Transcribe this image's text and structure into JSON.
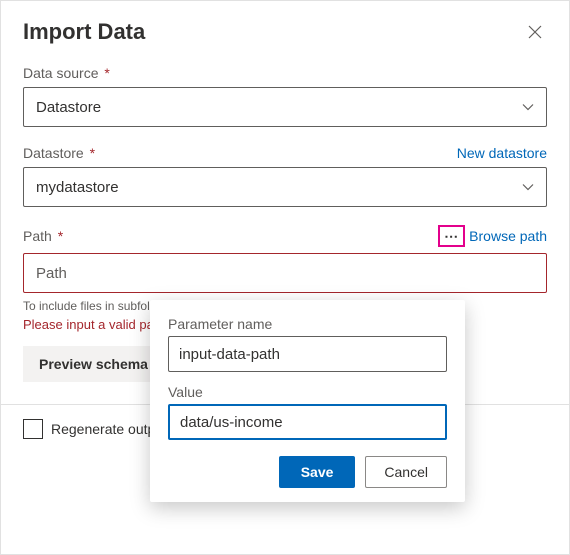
{
  "dialog": {
    "title": "Import Data"
  },
  "data_source": {
    "label": "Data source",
    "value": "Datastore"
  },
  "datastore": {
    "label": "Datastore",
    "new_link": "New datastore",
    "value": "mydatastore"
  },
  "path": {
    "label": "Path",
    "browse_link": "Browse path",
    "placeholder": "Path",
    "help_text": "To include files in subfolders, append '/**' after the folder name like '{folder}/**'.",
    "error": "Please input a valid path."
  },
  "preview_button": "Preview schema",
  "regenerate_label": "Regenerate output",
  "popover": {
    "param_label": "Parameter name",
    "param_value": "input-data-path",
    "value_label": "Value",
    "value_value": "data/us-income",
    "save": "Save",
    "cancel": "Cancel"
  }
}
